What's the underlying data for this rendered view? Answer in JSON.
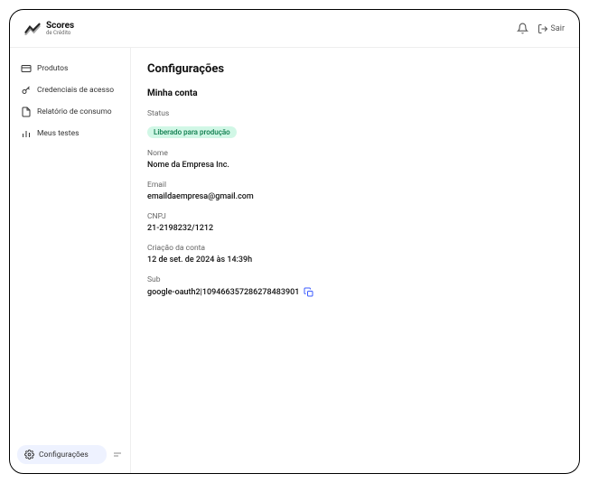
{
  "brand": {
    "title": "Scores",
    "subtitle": "de Crédito"
  },
  "topbar": {
    "logout_label": "Sair"
  },
  "sidebar": {
    "items": [
      {
        "label": "Produtos"
      },
      {
        "label": "Credenciais de acesso"
      },
      {
        "label": "Relatório de consumo"
      },
      {
        "label": "Meus testes"
      }
    ],
    "config_label": "Configurações"
  },
  "page": {
    "title": "Configurações",
    "section_title": "Minha conta",
    "fields": {
      "status": {
        "label": "Status",
        "badge": "Liberado para produção"
      },
      "name": {
        "label": "Nome",
        "value": "Nome da Empresa Inc."
      },
      "email": {
        "label": "Email",
        "value": "emaildaempresa@gmail.com"
      },
      "cnpj": {
        "label": "CNPJ",
        "value": "21-2198232/1212"
      },
      "created": {
        "label": "Criação da conta",
        "value": "12 de set. de 2024 às 14:39h"
      },
      "sub": {
        "label": "Sub",
        "value": "google-oauth2|109466357286278483901"
      }
    }
  }
}
